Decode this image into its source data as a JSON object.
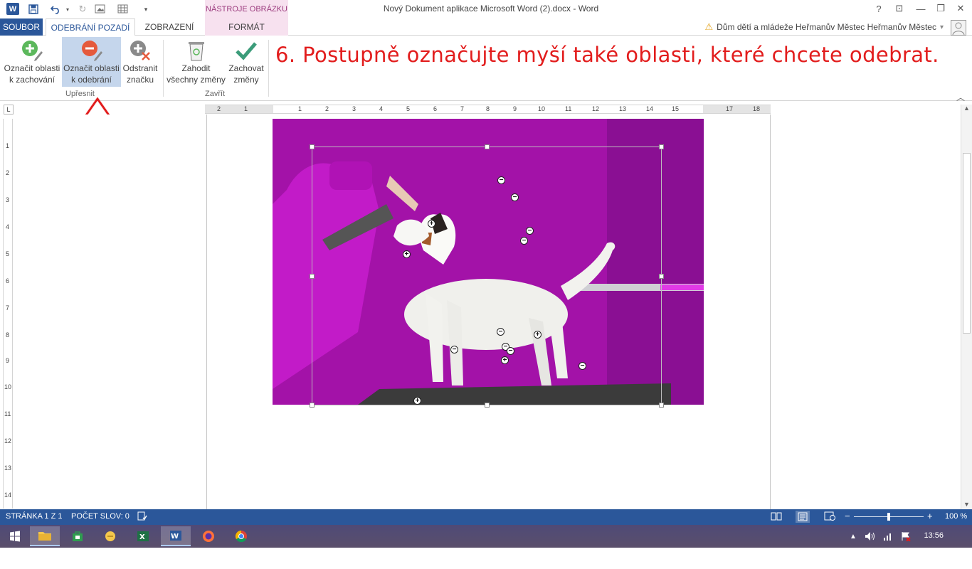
{
  "window": {
    "title": "Nový Dokument aplikace Microsoft Word (2).docx - Word",
    "app_icon": "W",
    "help": "?",
    "controls": {
      "restore_ribbon": "⊡",
      "minimize": "—",
      "maximize": "❐",
      "close": "✕"
    }
  },
  "quick_access": {
    "save_icon": "save-icon",
    "undo_icon": "undo-icon",
    "redo_icon": "redo-icon"
  },
  "context_group": "NÁSTROJE OBRÁZKU",
  "tabs": {
    "file": "SOUBOR",
    "remove_background": "ODEBRÁNÍ POZADÍ",
    "view": "ZOBRAZENÍ",
    "format": "FORMÁT"
  },
  "account": {
    "name": "Dům dětí a mládeže Heřmanův Městec Heřmanův Městec",
    "warning": "⚠",
    "dropdown": "▾"
  },
  "ribbon": {
    "buttons": [
      {
        "label": "Označit oblasti\nk zachování",
        "icon": "plus-pencil-icon"
      },
      {
        "label": "Označit oblasti\nk odebrání",
        "icon": "minus-pencil-icon"
      },
      {
        "label": "Odstranit\nznačku",
        "icon": "delete-mark-icon"
      },
      {
        "label": "Zahodit\nvšechny změny",
        "icon": "trash-icon"
      },
      {
        "label": "Zachovat\nzměny",
        "icon": "checkmark-icon"
      }
    ],
    "groups": {
      "refine": "Upřesnit",
      "close": "Zavřít"
    }
  },
  "instruction": "6. Postupně označujte myší také oblasti, které chcete odebrat.",
  "ruler": {
    "horizontal": [
      "2",
      "1",
      "1",
      "2",
      "3",
      "4",
      "5",
      "6",
      "7",
      "8",
      "9",
      "10",
      "11",
      "12",
      "13",
      "14",
      "15",
      "17",
      "18"
    ],
    "vertical": [
      "1",
      "2",
      "3",
      "4",
      "5",
      "6",
      "7",
      "8",
      "9",
      "10",
      "11",
      "12",
      "13",
      "14"
    ],
    "corner": "L"
  },
  "image": {
    "background_color": "#a312a8",
    "marks": [
      {
        "type": "minus"
      },
      {
        "type": "minus"
      },
      {
        "type": "minus"
      },
      {
        "type": "minus"
      },
      {
        "type": "plus"
      },
      {
        "type": "plus"
      },
      {
        "type": "minus"
      },
      {
        "type": "plus"
      },
      {
        "type": "minus"
      },
      {
        "type": "minus"
      },
      {
        "type": "minus"
      },
      {
        "type": "plus"
      },
      {
        "type": "minus"
      },
      {
        "type": "plus"
      }
    ]
  },
  "status": {
    "page": "STRÁNKA 1 Z 1",
    "words": "POČET SLOV: 0",
    "zoom": "100 %",
    "zoom_minus": "−",
    "zoom_plus": "+"
  },
  "taskbar": {
    "items": [
      "start-icon",
      "file-explorer-icon",
      "store-icon",
      "sticky-icon",
      "excel-icon",
      "word-icon",
      "firefox-icon",
      "chrome-icon"
    ],
    "time": "13:56"
  },
  "colors": {
    "accent": "#2b579a",
    "instruction": "#e21d1d",
    "context_tab": "#f7e1ef"
  }
}
